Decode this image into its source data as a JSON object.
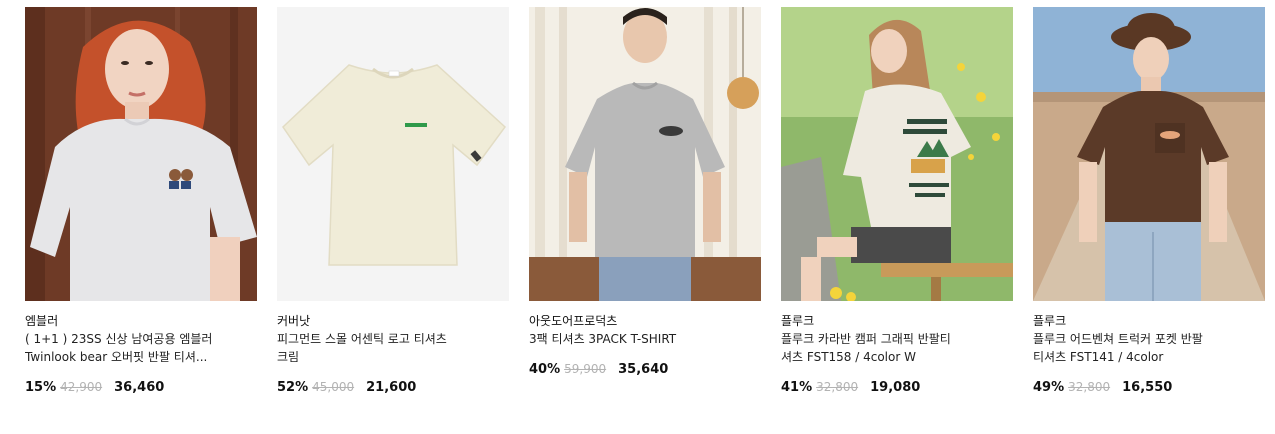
{
  "products": [
    {
      "brand": "엠블러",
      "title": "( 1+1 ) 23SS 신상 남여공용 엠블러\nTwinlook bear 오버핏 반팔 티셔...",
      "discount": "15%",
      "original_price": "42,900",
      "sale_price": "36,460",
      "image": "model-grey-tee-bear-logo"
    },
    {
      "brand": "커버낫",
      "title": "피그먼트 스몰 어센틱 로고 티셔츠\n크림",
      "discount": "52%",
      "original_price": "45,000",
      "sale_price": "21,600",
      "image": "cream-tee-flat"
    },
    {
      "brand": "아웃도어프로덕츠",
      "title": "3팩 티셔츠 3PACK T-SHIRT",
      "discount": "40%",
      "original_price": "59,900",
      "sale_price": "35,640",
      "image": "model-grey-tee-curtains"
    },
    {
      "brand": "플루크",
      "title": "플루크 카라반 캠퍼 그래픽 반팔티\n셔츠 FST158 / 4color W",
      "discount": "41%",
      "original_price": "32,800",
      "sale_price": "19,080",
      "image": "model-cream-tee-back-print"
    },
    {
      "brand": "플루크",
      "title": "플루크 어드벤쳐 트럭커 포켓 반팔\n티셔츠 FST141 / 4color",
      "discount": "49%",
      "original_price": "32,800",
      "sale_price": "16,550",
      "image": "model-brown-pocket-tee"
    }
  ]
}
